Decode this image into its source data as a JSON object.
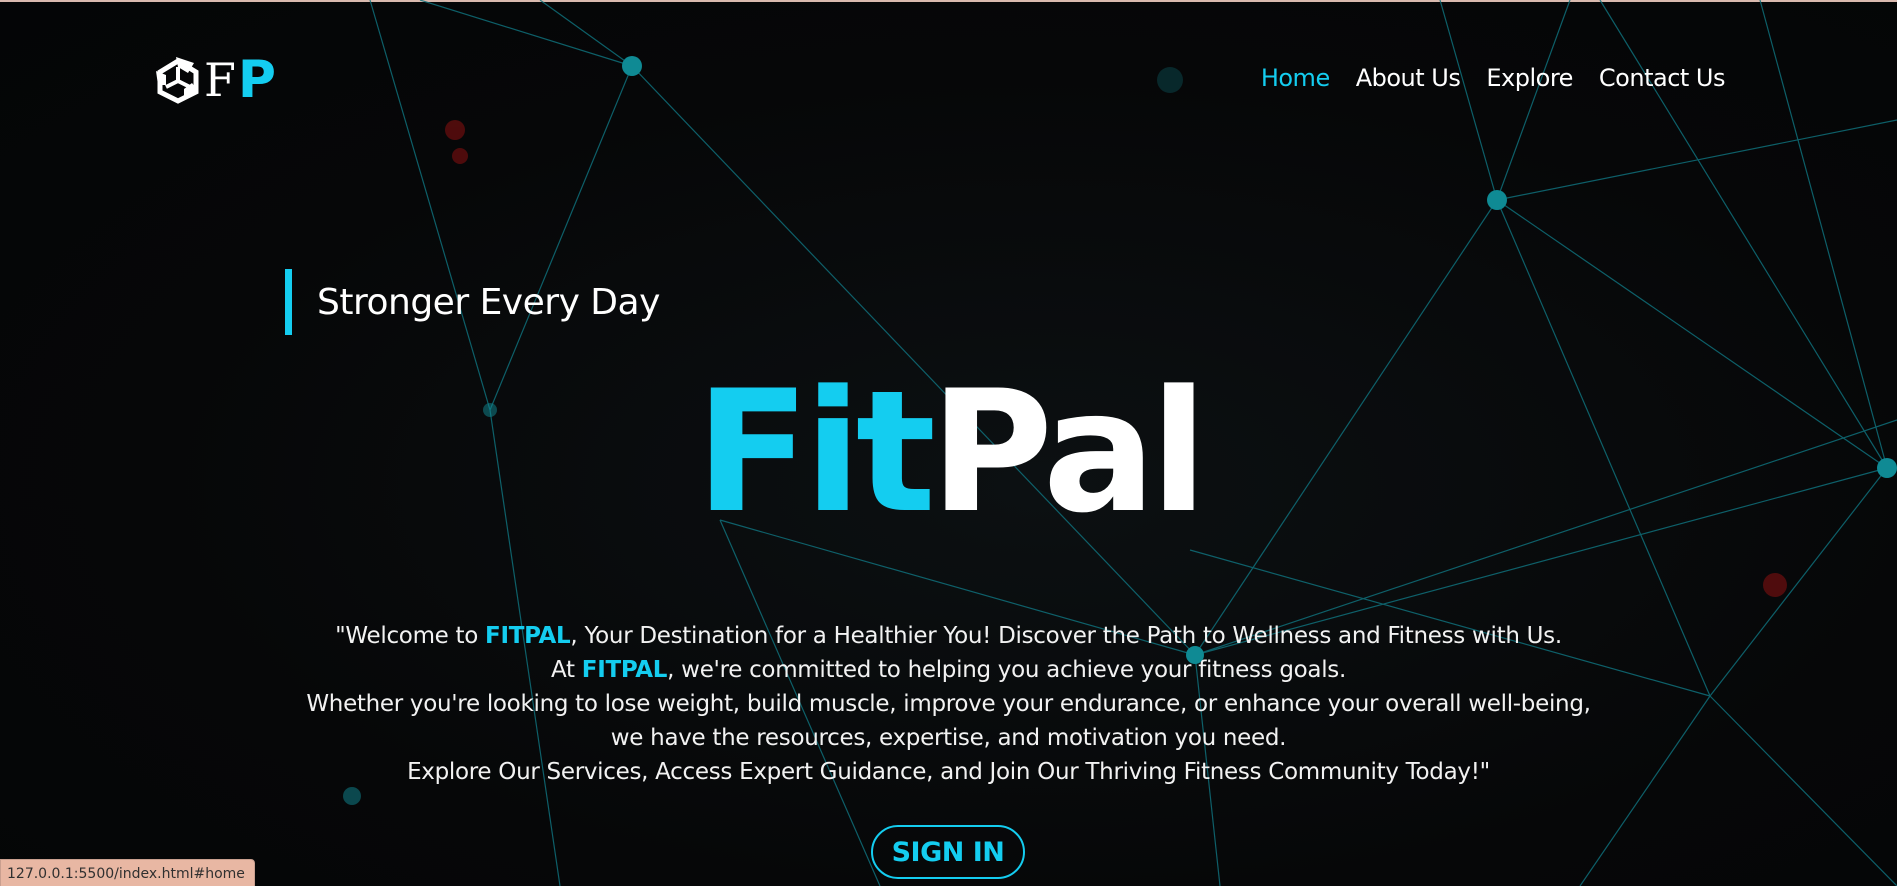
{
  "logo": {
    "icon": "unity-style-cube-icon",
    "letter_f": "F",
    "letter_p": "P"
  },
  "nav": {
    "items": [
      {
        "label": "Home",
        "active": true
      },
      {
        "label": "About Us",
        "active": false
      },
      {
        "label": "Explore",
        "active": false
      },
      {
        "label": "Contact Us",
        "active": false
      }
    ]
  },
  "hero": {
    "tagline": "Stronger Every Day",
    "brand_part1": "Fit",
    "brand_part2": "Pal",
    "description": {
      "line1_prefix": "\"Welcome to ",
      "line1_highlight": "FITPAL",
      "line1_suffix": ", Your Destination for a Healthier You! Discover the Path to Wellness and Fitness with Us.",
      "line2_prefix": "At ",
      "line2_highlight": "FITPAL",
      "line2_suffix": ", we're committed to helping you achieve your fitness goals.",
      "line3": "Whether you're looking to lose weight, build muscle, improve your endurance, or enhance your overall well-being,",
      "line4": "we have the resources, expertise, and motivation you need.",
      "line5": "Explore Our Services, Access Expert Guidance, and Join Our Thriving Fitness Community Today!\""
    },
    "signin_label": "SIGN IN"
  },
  "status_bar": {
    "url": "127.0.0.1:5500/index.html#home"
  },
  "colors": {
    "accent": "#14cdf0",
    "background": "#060708",
    "text": "#ffffff",
    "network_line": "#0f6f7a",
    "status_bar_bg": "#e8b7a3"
  }
}
